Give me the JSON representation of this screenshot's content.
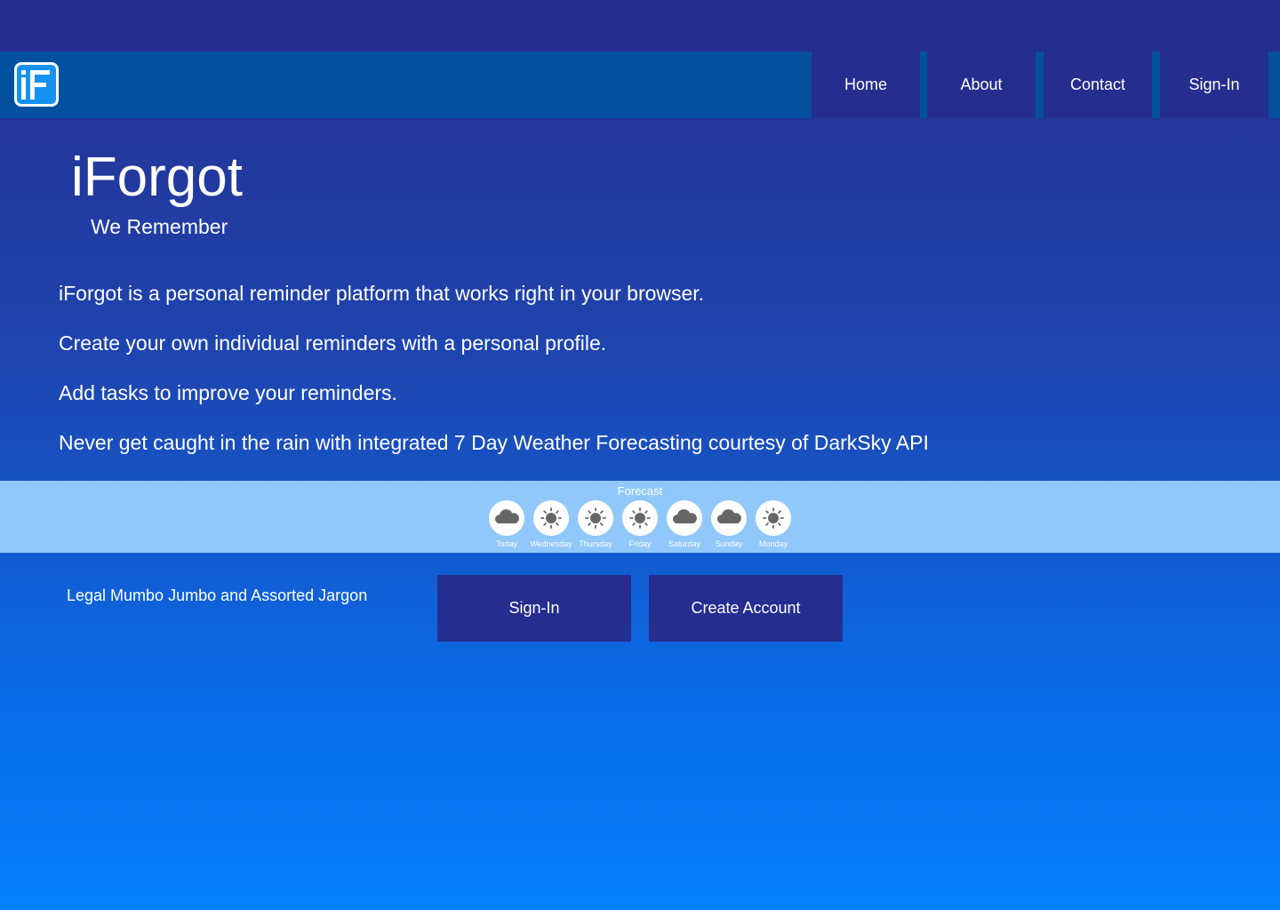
{
  "nav": {
    "logo_text": "iF",
    "items": [
      {
        "label": "Home"
      },
      {
        "label": "About"
      },
      {
        "label": "Contact"
      },
      {
        "label": "Sign-In"
      }
    ]
  },
  "hero": {
    "title": "iForgot",
    "tagline": "We Remember",
    "features": [
      "iForgot is a personal reminder platform that works right in your browser.",
      "Create your own individual reminders with a personal profile.",
      "Add tasks to improve your reminders.",
      "Never get caught in the rain with integrated 7 Day Weather Forecasting courtesy of DarkSky API"
    ]
  },
  "forecast": {
    "title": "Forecast",
    "days": [
      {
        "label": "Today",
        "icon": "cloud-icon"
      },
      {
        "label": "Wednesday",
        "icon": "sun-icon"
      },
      {
        "label": "Thursday",
        "icon": "sun-icon"
      },
      {
        "label": "Friday",
        "icon": "sun-icon"
      },
      {
        "label": "Saturday",
        "icon": "cloud-icon"
      },
      {
        "label": "Sunday",
        "icon": "cloud-icon"
      },
      {
        "label": "Monday",
        "icon": "sun-icon"
      }
    ]
  },
  "footer": {
    "legal": "Legal Mumbo Jumbo and Assorted Jargon",
    "signin_label": "Sign-In",
    "create_label": "Create Account"
  },
  "colors": {
    "nav_button": "#252d8f",
    "navbar": "#03509f",
    "forecast_bar": "#91c8fb",
    "logo_blue": "#1591f0",
    "icon_gray": "#666666"
  }
}
